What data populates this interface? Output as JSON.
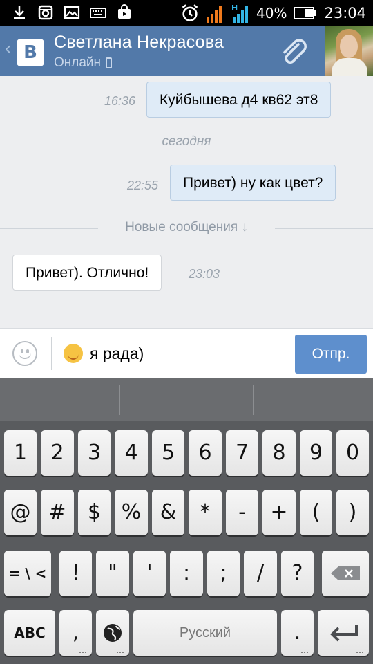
{
  "status_bar": {
    "battery": "40%",
    "time": "23:04",
    "signal_letter": "H"
  },
  "header": {
    "back_glyph": "‹",
    "logo_letter": "В",
    "contact_name": "Светлана Некрасова",
    "status": "Онлайн",
    "accent_color": "#5279a9"
  },
  "messages": [
    {
      "direction": "out",
      "text": "Куйбышева д4 кв62 эт8",
      "time": "16:36"
    },
    {
      "direction": "out",
      "text": "Привет) ну как цвет?",
      "time": "22:55"
    },
    {
      "direction": "in",
      "text": "Привет). Отлично!",
      "time": "23:03"
    }
  ],
  "date_separator": "сегодня",
  "new_messages_label": "Новые сообщения ↓",
  "input": {
    "value": "я рада)",
    "emoji_icon": "smiling-face-icon",
    "send_label": "Отпр."
  },
  "keyboard": {
    "row1": [
      "1",
      "2",
      "3",
      "4",
      "5",
      "6",
      "7",
      "8",
      "9",
      "0"
    ],
    "row2": [
      "@",
      "#",
      "$",
      "%",
      "&",
      "*",
      "-",
      "+",
      "(",
      ")"
    ],
    "row3": [
      "= \\ <",
      "!",
      "\"",
      "'",
      ":",
      ";",
      "/",
      "?"
    ],
    "abc_label": "ABC",
    "comma_label": ",",
    "space_label": "Русский",
    "period_label": "."
  }
}
